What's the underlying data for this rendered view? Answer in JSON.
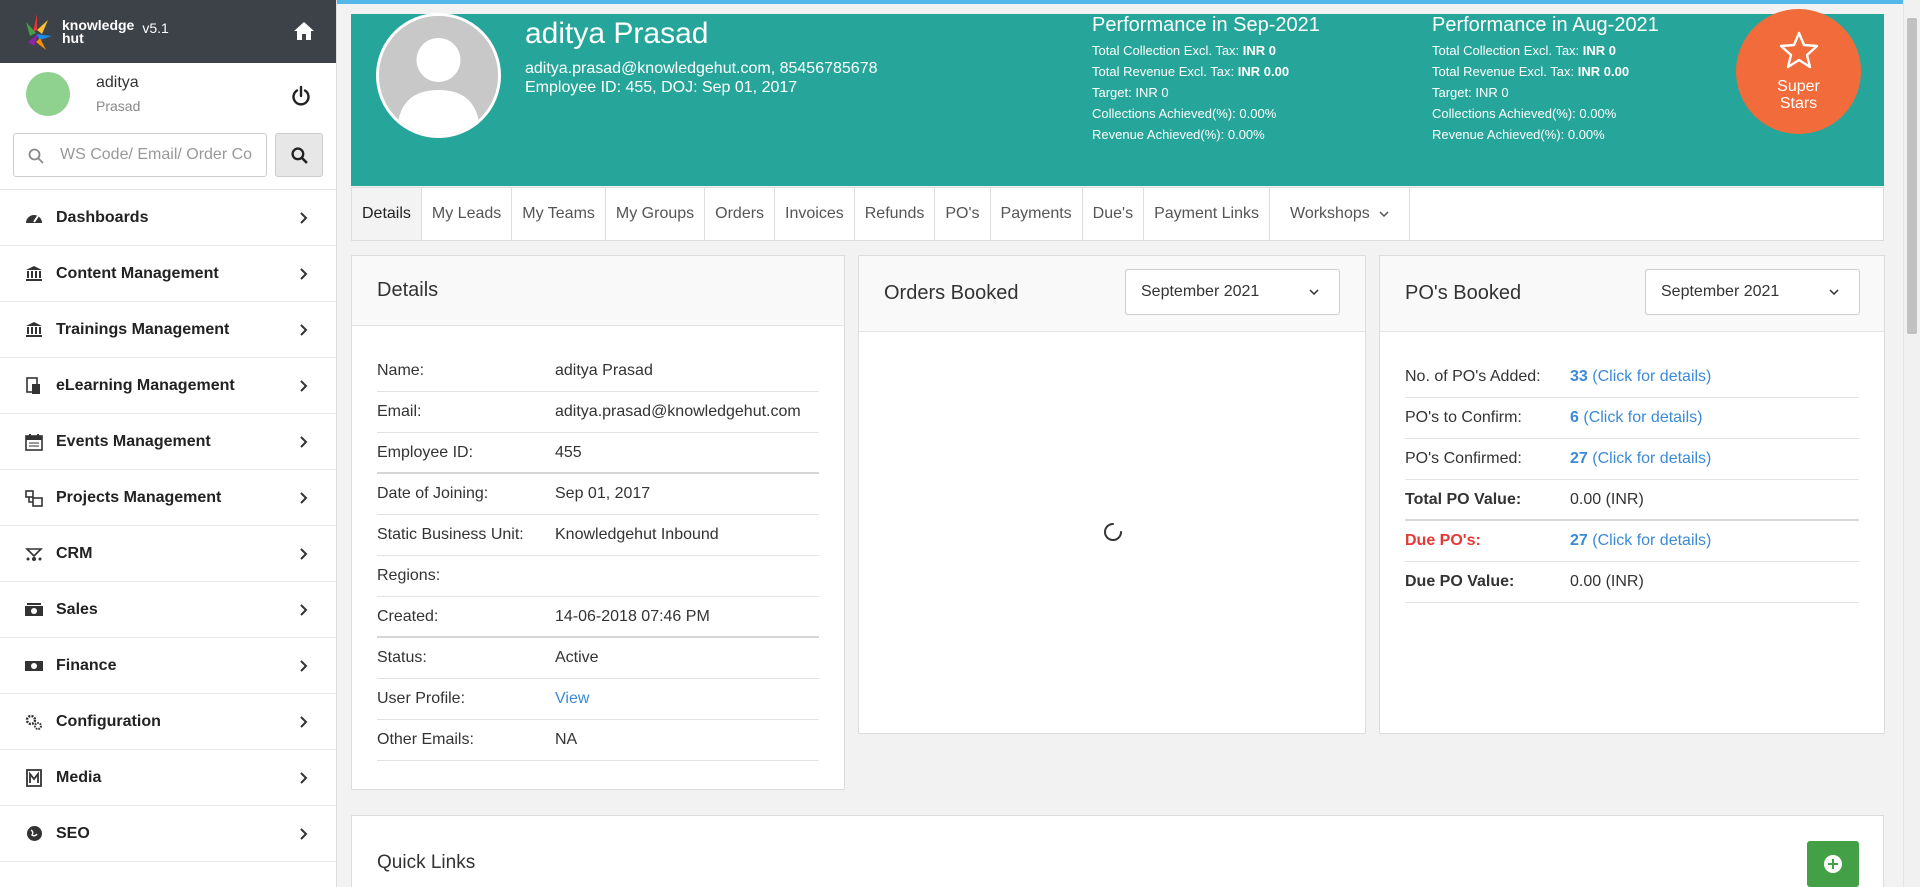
{
  "brand": {
    "name_line1": "knowledge",
    "name_line2": "hut",
    "version": "v5.1",
    "logo_icon": "knowledgehut-logo",
    "home_icon": "home-icon"
  },
  "user": {
    "first_name": "aditya",
    "last_name": "Prasad",
    "power_icon": "power-icon"
  },
  "search": {
    "placeholder": "WS Code/ Email/ Order Co",
    "icon": "search-icon"
  },
  "nav": [
    {
      "label": "Dashboards",
      "icon": "dashboard-icon"
    },
    {
      "label": "Content Management",
      "icon": "bank-icon"
    },
    {
      "label": "Trainings Management",
      "icon": "bank-icon"
    },
    {
      "label": "eLearning Management",
      "icon": "elearning-icon"
    },
    {
      "label": "Events Management",
      "icon": "calendar-icon"
    },
    {
      "label": "Projects Management",
      "icon": "projects-icon"
    },
    {
      "label": "CRM",
      "icon": "crm-icon"
    },
    {
      "label": "Sales",
      "icon": "money-icon"
    },
    {
      "label": "Finance",
      "icon": "money-icon"
    },
    {
      "label": "Configuration",
      "icon": "gears-icon"
    },
    {
      "label": "Media",
      "icon": "media-icon"
    },
    {
      "label": "SEO",
      "icon": "globe-icon"
    }
  ],
  "profile": {
    "name": "aditya Prasad",
    "contact": "aditya.prasad@knowledgehut.com, 85456785678",
    "employee_line": "Employee ID: 455, DOJ: Sep 01, 2017"
  },
  "performance": [
    {
      "title": "Performance in Sep-2021",
      "collection_label": "Total Collection Excl. Tax:",
      "collection_value": "INR 0",
      "revenue_label": "Total Revenue Excl. Tax:",
      "revenue_value": "INR 0.00",
      "target": "Target: INR 0",
      "collections_achieved": "Collections Achieved(%): 0.00%",
      "revenue_achieved": "Revenue Achieved(%): 0.00%"
    },
    {
      "title": "Performance in Aug-2021",
      "collection_label": "Total Collection Excl. Tax:",
      "collection_value": "INR 0",
      "revenue_label": "Total Revenue Excl. Tax:",
      "revenue_value": "INR 0.00",
      "target": "Target: INR 0",
      "collections_achieved": "Collections Achieved(%): 0.00%",
      "revenue_achieved": "Revenue Achieved(%): 0.00%"
    }
  ],
  "superstar": {
    "line1": "Super",
    "line2": "Stars",
    "icon": "star-icon"
  },
  "tabs": [
    "Details",
    "My Leads",
    "My Teams",
    "My Groups",
    "Orders",
    "Invoices",
    "Refunds",
    "PO's",
    "Payments",
    "Due's",
    "Payment Links",
    "Workshops"
  ],
  "details": {
    "title": "Details",
    "rows": [
      {
        "key": "Name:",
        "value": "aditya Prasad"
      },
      {
        "key": "Email:",
        "value": "aditya.prasad@knowledgehut.com"
      },
      {
        "key": "Employee ID:",
        "value": "455"
      },
      {
        "key": "Date of Joining:",
        "value": "Sep 01, 2017"
      },
      {
        "key": "Static Business Unit:",
        "value": "Knowledgehut Inbound"
      },
      {
        "key": "Regions:",
        "value": ""
      },
      {
        "key": "Created:",
        "value": "14-06-2018 07:46 PM"
      },
      {
        "key": "Status:",
        "value": "Active"
      },
      {
        "key": "User Profile:",
        "value": "View"
      },
      {
        "key": "Other Emails:",
        "value": "NA"
      }
    ]
  },
  "orders_booked": {
    "title": "Orders Booked",
    "month": "September 2021"
  },
  "pos_booked": {
    "title": "PO's Booked",
    "month": "September 2021",
    "rows": [
      {
        "key": "No. of PO's Added:",
        "num": "33",
        "link": "(Click for details)"
      },
      {
        "key": "PO's to Confirm:",
        "num": "6",
        "link": "(Click for details)"
      },
      {
        "key": "PO's Confirmed:",
        "num": "27",
        "link": "(Click for details)"
      },
      {
        "key": "Total PO Value:",
        "value": "0.00 (INR)"
      },
      {
        "key": "Due PO's:",
        "num": "27",
        "link": "(Click for details)"
      },
      {
        "key": "Due PO Value:",
        "value": "0.00 (INR)"
      }
    ]
  },
  "quick_links": {
    "title": "Quick Links",
    "add_icon": "plus-icon"
  },
  "colors": {
    "header_teal": "#26a69a",
    "superstar_orange": "#f26b3a",
    "link_blue": "#3b8ad8",
    "due_red": "#e53935",
    "add_green": "#43a047",
    "sidebar_dark": "#3d4148"
  }
}
